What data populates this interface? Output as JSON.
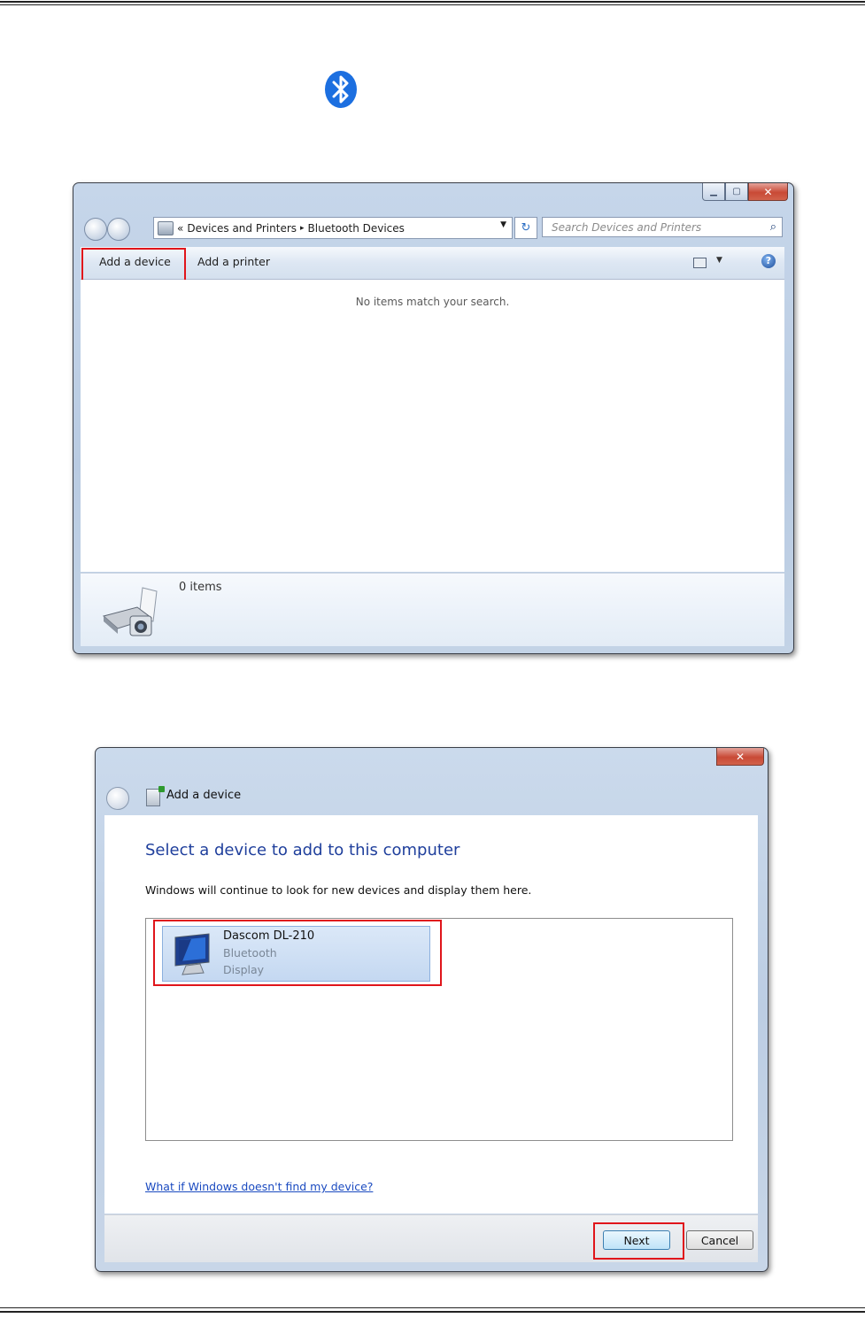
{
  "window1": {
    "breadcrumb": {
      "chevron": "«",
      "parent": "Devices and Printers",
      "separator": "▸",
      "current": "Bluetooth Devices"
    },
    "search_placeholder": "Search Devices and Printers",
    "toolbar": {
      "add_device": "Add a device",
      "add_printer": "Add a printer"
    },
    "empty_message": "No items match your search.",
    "status_count": "0 items"
  },
  "window2": {
    "title": "Add a device",
    "heading": "Select a device to add to this computer",
    "description": "Windows will continue to look for new devices and display them here.",
    "device": {
      "name": "Dascom DL-210",
      "type": "Bluetooth",
      "category": "Display"
    },
    "help_link": "What if Windows doesn't find my device?",
    "next_label": "Next",
    "cancel_label": "Cancel"
  },
  "icons": {
    "bluetooth": "bluetooth-icon",
    "printer": "printer-icon",
    "monitor": "monitor-icon"
  },
  "colors": {
    "highlight_box": "#e0151b",
    "heading_blue": "#1f3f9c",
    "link_blue": "#1a4ac0",
    "bluetooth_blue": "#1c6fe0"
  }
}
